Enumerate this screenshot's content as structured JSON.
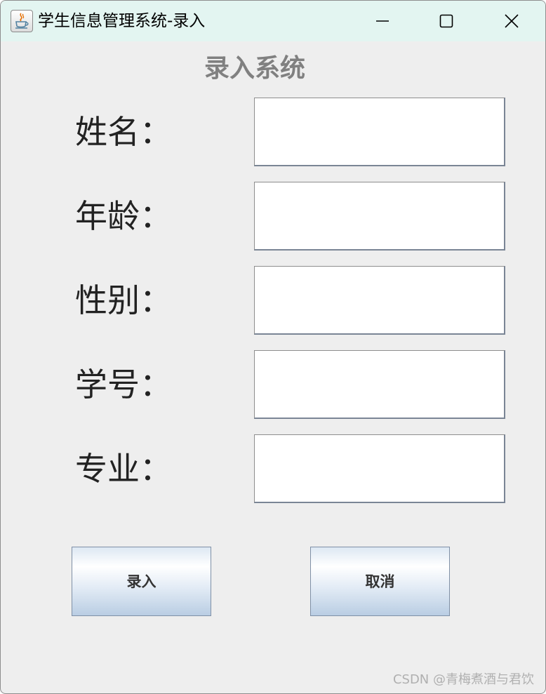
{
  "window": {
    "title": "学生信息管理系统-录入",
    "app_icon": "java-cup-icon",
    "controls": [
      "minimize-icon",
      "maximize-icon",
      "close-icon"
    ]
  },
  "form": {
    "heading": "录入系统",
    "fields": [
      {
        "label": "姓名：",
        "value": ""
      },
      {
        "label": "年龄：",
        "value": ""
      },
      {
        "label": "性别：",
        "value": ""
      },
      {
        "label": "学号：",
        "value": ""
      },
      {
        "label": "专业：",
        "value": ""
      }
    ]
  },
  "buttons": {
    "submit_label": "录入",
    "cancel_label": "取消"
  },
  "watermark": "CSDN @青梅煮酒与君饮",
  "colors": {
    "titlebar": "#e3f5f1",
    "window_bg": "#eeeeee",
    "heading": "#808080",
    "button_gradient_bottom": "#b9cde3"
  }
}
